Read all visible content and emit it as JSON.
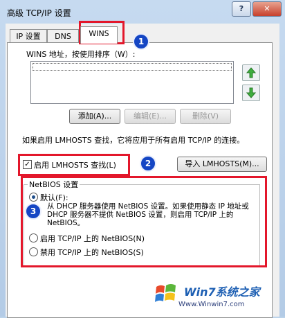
{
  "window": {
    "title": "高级 TCP/IP 设置",
    "help_glyph": "?",
    "close_glyph": "✕"
  },
  "tabs": [
    {
      "label": "IP 设置"
    },
    {
      "label": "DNS"
    },
    {
      "label": "WINS",
      "active": true
    }
  ],
  "wins": {
    "list_label": "WINS 地址，按使用排序（W）:",
    "up_arrow": "⇧",
    "down_arrow": "⇩",
    "add_button": "添加(A)...",
    "edit_button": "编辑(E)...",
    "delete_button": "删除(V)"
  },
  "lmhosts": {
    "description": "如果启用 LMHOSTS 查找，它将应用于所有启用 TCP/IP 的连接。",
    "enable_label": "启用 LMHOSTS 查找(L)",
    "enable_checked": true,
    "import_button": "导入 LMHOSTS(M)..."
  },
  "netbios": {
    "group_title": "NetBIOS 设置",
    "default_label": "默认(F):",
    "default_desc": "从 DHCP 服务器使用 NetBIOS 设置。如果使用静态 IP 地址或 DHCP 服务器不提供 NetBIOS 设置，则启用 TCP/IP 上的 NetBIOS。",
    "enable_label": "启用 TCP/IP 上的 NetBIOS(N)",
    "disable_label": "禁用 TCP/IP 上的 NetBIOS(S)",
    "selected": "default"
  },
  "annotations": {
    "badge1": "1",
    "badge2": "2",
    "badge3": "3"
  },
  "watermark": {
    "brand": "Win7系统之家",
    "url": "Www.Winwin7.com"
  },
  "colors": {
    "annotation_red": "#e3172b",
    "badge_blue": "#1546c4"
  }
}
